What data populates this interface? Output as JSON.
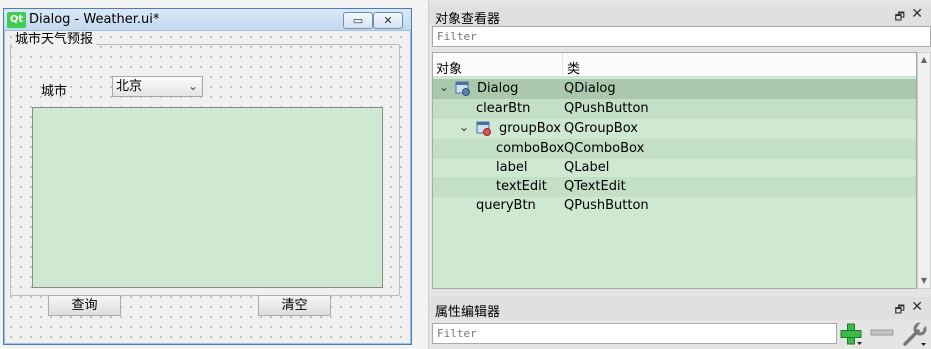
{
  "form_window": {
    "logo": "Qt",
    "title": "Dialog - Weather.ui*",
    "minimize_glyph": "▭",
    "close_glyph": "✕",
    "groupbox_title": "城市天气预报",
    "city_label": "城市",
    "city_combo_value": "北京",
    "combo_arrow": "⌄",
    "query_button": "查询",
    "clear_button": "清空"
  },
  "object_inspector": {
    "title": "对象查看器",
    "float_glyph": "🗗",
    "close_glyph": "✕",
    "filter_placeholder": "Filter",
    "columns": [
      "对象",
      "类"
    ],
    "rows": [
      {
        "name": "Dialog",
        "class": "QDialog",
        "expander": "⌄",
        "icon": "dialog-icon"
      },
      {
        "name": "clearBtn",
        "class": "QPushButton"
      },
      {
        "name": "groupBox",
        "class": "QGroupBox",
        "expander": "⌄",
        "icon": "groupbox-icon"
      },
      {
        "name": "comboBox",
        "class": "QComboBox"
      },
      {
        "name": "label",
        "class": "QLabel"
      },
      {
        "name": "textEdit",
        "class": "QTextEdit"
      },
      {
        "name": "queryBtn",
        "class": "QPushButton"
      }
    ],
    "scroll_up": "▲",
    "scroll_down": "▼"
  },
  "property_editor": {
    "title": "属性编辑器",
    "float_glyph": "🗗",
    "close_glyph": "✕",
    "filter_placeholder": "Filter"
  },
  "colors": {
    "text_edit_bg": "#cee8d1",
    "tree_bg": "#cee8d1",
    "tree_selected": "#a9c8ad",
    "add_icon": "#3bb84a"
  }
}
